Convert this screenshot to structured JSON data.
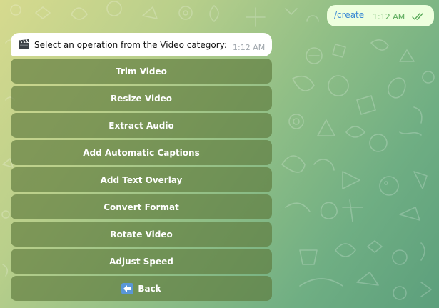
{
  "outgoing": {
    "text": "/create",
    "time": "1:12 AM",
    "status_icon": "double-check-icon",
    "colors": {
      "bubble": "#eeffde",
      "link": "#3a8ad4",
      "meta": "#5aaa5a"
    }
  },
  "incoming": {
    "icon": "clapperboard-icon",
    "text": "Select an operation from the Video category:",
    "time": "1:12 AM"
  },
  "keyboard": {
    "buttons": [
      {
        "label": "Trim Video"
      },
      {
        "label": "Resize Video"
      },
      {
        "label": "Extract Audio"
      },
      {
        "label": "Add Automatic Captions"
      },
      {
        "label": "Add Text Overlay"
      },
      {
        "label": "Convert Format"
      },
      {
        "label": "Rotate Video"
      },
      {
        "label": "Adjust Speed"
      },
      {
        "label": "Back",
        "icon": "back-arrow-icon"
      }
    ],
    "colors": {
      "button": "#5e7a3c",
      "text": "#ffffff",
      "back_icon": "#5a97d8"
    }
  }
}
